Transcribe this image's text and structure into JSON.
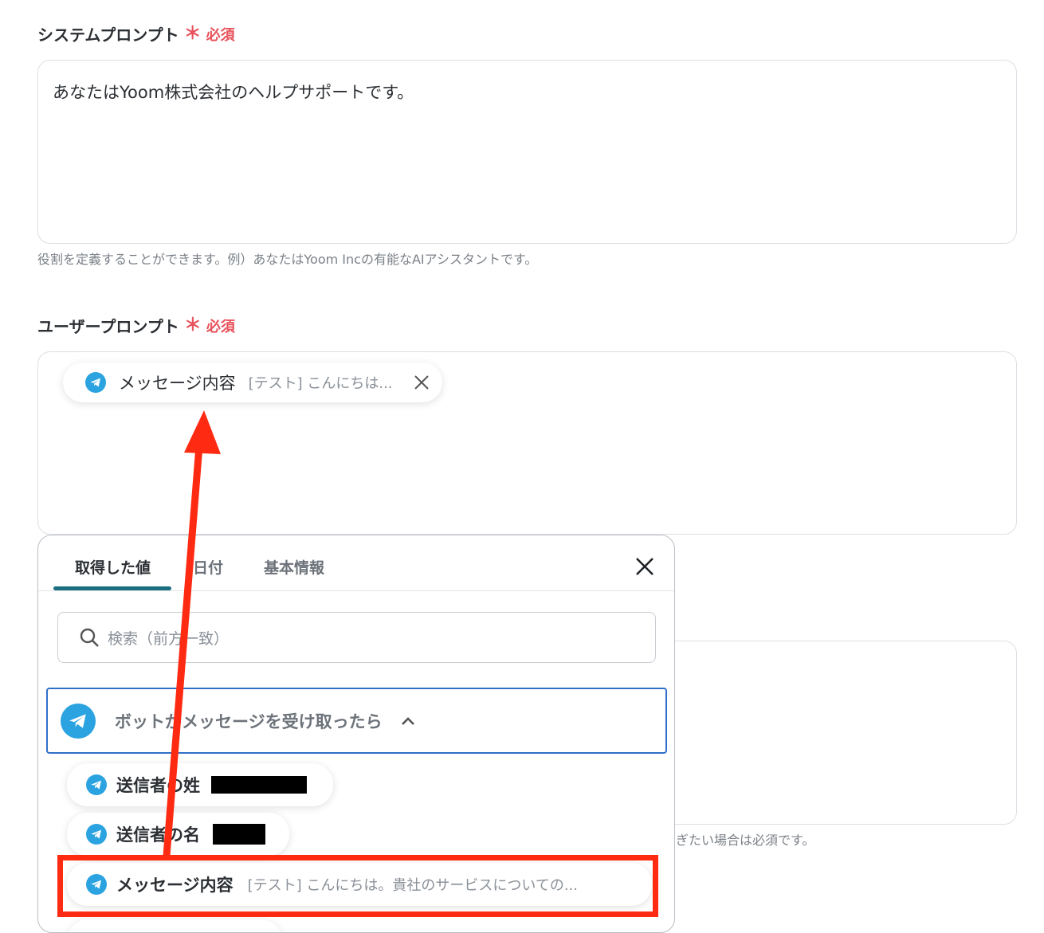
{
  "system_prompt": {
    "label": "システムプロンプト",
    "required_star": "＊",
    "required_text": "必須",
    "value": "あなたはYoom株式会社のヘルプサポートです。",
    "hint": "役割を定義することができます。例）あなたはYoom Incの有能なAIアシスタントです。"
  },
  "user_prompt": {
    "label": "ユーザープロンプト",
    "required_star": "＊",
    "required_text": "必須",
    "chip": {
      "icon": "telegram-icon",
      "title": "メッセージ内容",
      "preview": "[テスト] こんにちは...",
      "remove_icon": "close-icon"
    }
  },
  "partial_hint": "ぎたい場合は必須です。",
  "popup": {
    "tabs": [
      {
        "label": "取得した値",
        "active": true
      },
      {
        "label": "日付",
        "active": false
      },
      {
        "label": "基本情報",
        "active": false
      }
    ],
    "close_icon": "close-icon",
    "search": {
      "icon": "search-icon",
      "placeholder": "検索（前方一致）"
    },
    "group": {
      "icon": "telegram-icon",
      "label": "ボットがメッセージを受け取ったら",
      "toggle_icon": "chevron-up-icon"
    },
    "items": [
      {
        "icon": "telegram-icon",
        "title": "送信者の姓",
        "preview": ""
      },
      {
        "icon": "telegram-icon",
        "title": "送信者の名",
        "preview": ""
      },
      {
        "icon": "telegram-icon",
        "title": "メッセージ内容",
        "preview": "[テスト] こんにちは。貴社のサービスについての..."
      }
    ]
  },
  "annotation": {
    "arrow_color": "#ff2a12",
    "highlight_color": "#ff2a12"
  },
  "colors": {
    "required": "#e8525b",
    "accent_tab": "#1a6e80",
    "telegram": "#2aa3e0",
    "group_border": "#2f6fc9"
  }
}
